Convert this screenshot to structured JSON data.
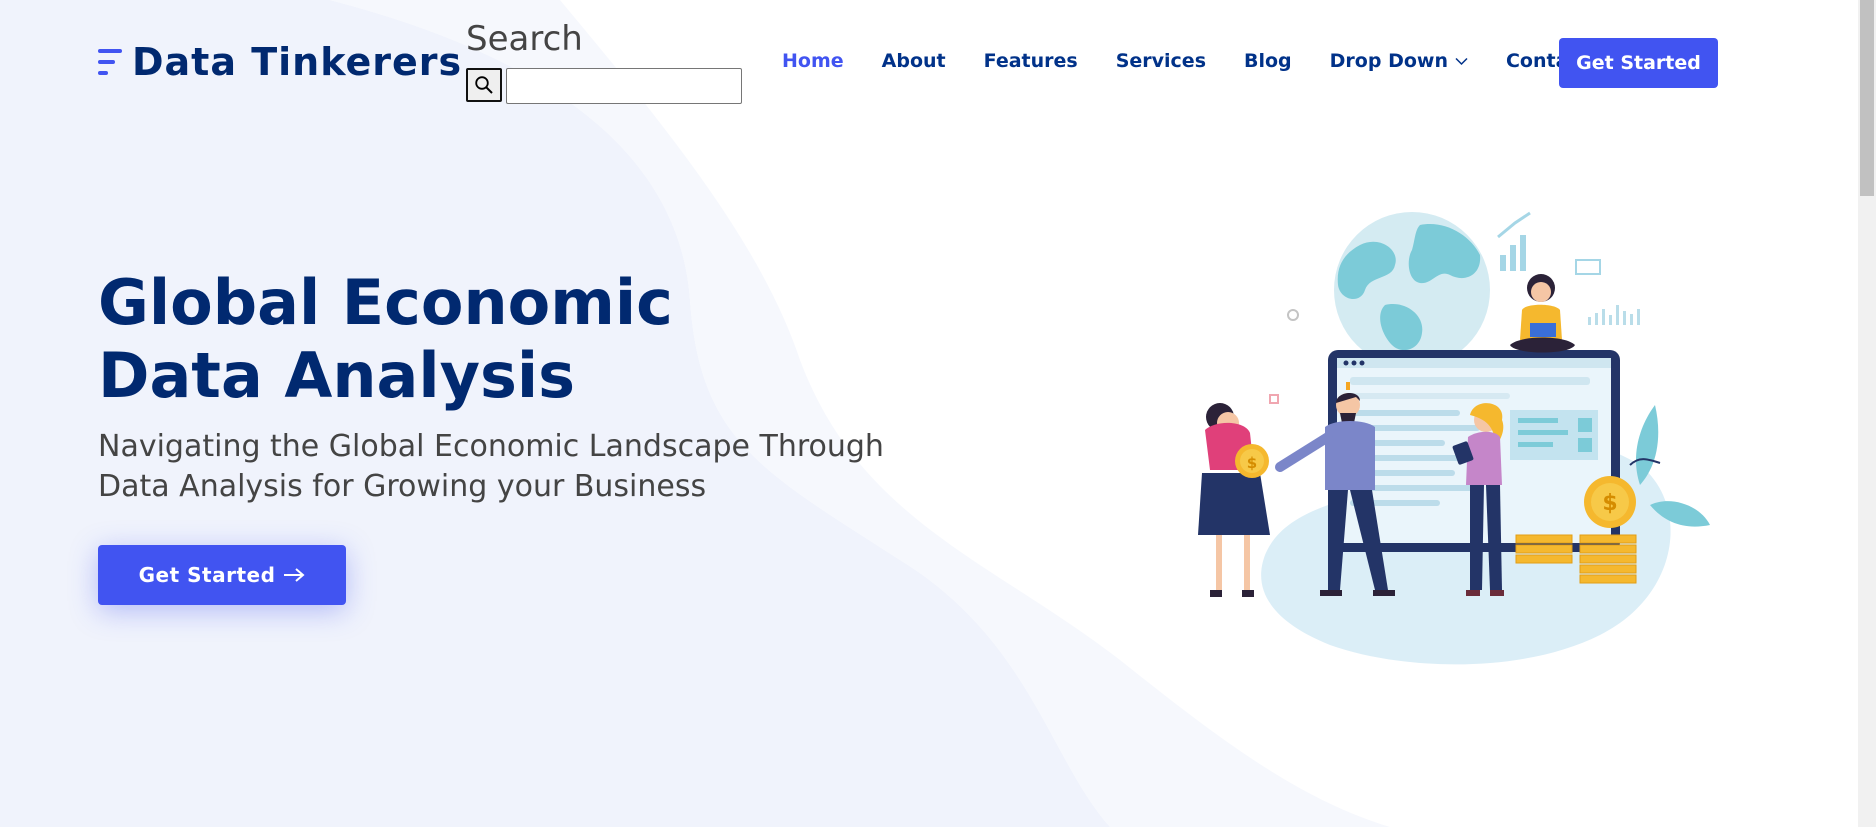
{
  "brand": {
    "name": "Data Tinkerers",
    "accent": "#4154f1",
    "navy": "#012970"
  },
  "search": {
    "label": "Search",
    "placeholder": "",
    "value": ""
  },
  "nav": {
    "items": [
      {
        "label": "Home",
        "active": true
      },
      {
        "label": "About",
        "active": false
      },
      {
        "label": "Features",
        "active": false
      },
      {
        "label": "Services",
        "active": false
      },
      {
        "label": "Blog",
        "active": false
      },
      {
        "label": "Drop Down",
        "active": false,
        "icon": "chevron-down-icon"
      },
      {
        "label": "Contact",
        "active": false
      }
    ],
    "cta_label": "Get Started"
  },
  "hero": {
    "title": "Global Economic Data Analysis",
    "subtitle": "Navigating the Global Economic Landscape Through Data Analysis for Growing your Business",
    "cta_label": "Get Started",
    "cta_icon": "arrow-right-icon",
    "illustration_icon": "business-people-data-analysis-illustration"
  }
}
